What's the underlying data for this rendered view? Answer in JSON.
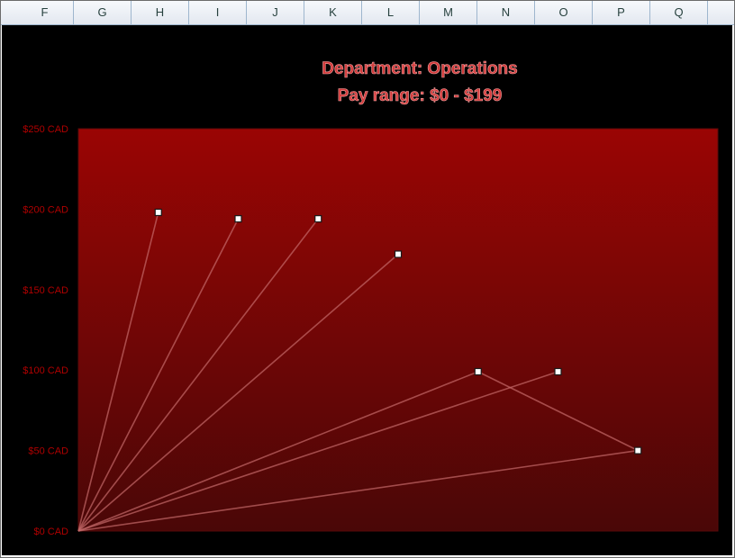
{
  "spreadsheet": {
    "columns": [
      "F",
      "G",
      "H",
      "I",
      "J",
      "K",
      "L",
      "M",
      "N",
      "O",
      "P",
      "Q"
    ]
  },
  "chart_data": {
    "type": "scatter",
    "title": "Department:  Operations",
    "subtitle": "Pay range:  $0 - $199",
    "ylim": [
      0,
      250
    ],
    "xlim": [
      0,
      8
    ],
    "yticks": [
      "$0 CAD",
      "$50 CAD",
      "$100 CAD",
      "$150 CAD",
      "$200 CAD",
      "$250 CAD"
    ],
    "ytick_values": [
      0,
      50,
      100,
      150,
      200,
      250
    ],
    "grid": false,
    "legend": "none",
    "points": [
      {
        "x": 1,
        "y": 198
      },
      {
        "x": 2,
        "y": 194
      },
      {
        "x": 3,
        "y": 194
      },
      {
        "x": 4,
        "y": 172
      },
      {
        "x": 5,
        "y": 99
      },
      {
        "x": 6,
        "y": 99
      },
      {
        "x": 7,
        "y": 50
      }
    ],
    "colors": {
      "background": "#000000",
      "plot_top": "#9a0504",
      "plot_bottom": "#4a0707",
      "title": "#d43a3a",
      "title_outline": "#f2a3a3",
      "tick_label": "#b00000",
      "line": "#c56a6a",
      "marker_fill": "#ffffff",
      "marker_stroke": "#1a1a1a"
    }
  }
}
